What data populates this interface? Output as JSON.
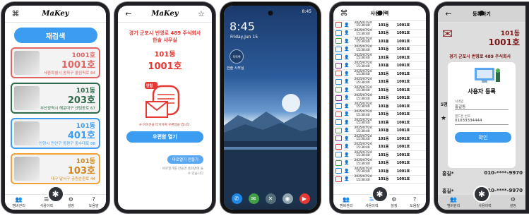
{
  "phone1": {
    "brand": "MaKey",
    "search_button": "재검색",
    "units": [
      {
        "dong": "1001호",
        "ho": "1001호",
        "addr": "세종특별시 송파구 올림픽로 84",
        "color": "#e06666"
      },
      {
        "dong": "101동",
        "ho": "203호",
        "addr": "부산광역시 해운대구 센텀동로 67",
        "color": "#2e6b4a"
      },
      {
        "dong": "101동",
        "ho": "401호",
        "addr": "안양시 만안구 동편구 중수대로 88",
        "color": "#3b9cf0"
      },
      {
        "dong": "101동",
        "ho": "103호",
        "addr": "대구 달서구 공원순환로 44",
        "color": "#f0a23b"
      }
    ],
    "nav": [
      {
        "icon": "users-icon",
        "label": "멤버관리"
      },
      {
        "icon": "history-icon",
        "label": "사용이력"
      },
      {
        "icon": "settings-icon",
        "label": "설정"
      },
      {
        "icon": "help-icon",
        "label": "도움말"
      }
    ]
  },
  "phone2": {
    "brand": "MaKey",
    "title": "경기 군포시 번영로 489 주식회사 한솔 사무실",
    "dong": "101동",
    "ho": "1001호",
    "badge": "단힘",
    "warning": "※ 아이콘을 터치하여 우편함을 엽니다.",
    "open_button": "우편함 열기",
    "make_key_button": "마로열기 만들기",
    "hint": "바로열기를 만들면 홈화면에 둘 수 있습니다"
  },
  "phone3": {
    "status_time": "8:45",
    "clock": "8:45",
    "date": "Friday,Jun 15",
    "app_icon": "독목팩",
    "app_label": "한솔 사무실"
  },
  "phone4": {
    "title": "사용이력",
    "rows": [
      {
        "date": "2025/07/24",
        "time": "15:30:40",
        "dong": "101동",
        "ho": "1001호",
        "color": "#e53935"
      },
      {
        "date": "2025/07/24",
        "time": "15:30:40",
        "dong": "101동",
        "ho": "1001호",
        "color": "#1e88e5"
      },
      {
        "date": "2025/07/24",
        "time": "15:30:40",
        "dong": "101동",
        "ho": "1001호",
        "color": "#43a047"
      },
      {
        "date": "2025/07/24",
        "time": "15:30:40",
        "dong": "101동",
        "ho": "1001호",
        "color": "#1e88e5"
      },
      {
        "date": "2025/07/24",
        "time": "15:30:40",
        "dong": "101동",
        "ho": "1001호",
        "color": "#1e88e5"
      },
      {
        "date": "2025/07/24",
        "time": "15:30:40",
        "dong": "101동",
        "ho": "1001호",
        "color": "#8e24aa"
      },
      {
        "date": "2025/07/24",
        "time": "15:30:40",
        "dong": "101동",
        "ho": "1001호",
        "color": "#e53935"
      },
      {
        "date": "2025/07/24",
        "time": "15:30:40",
        "dong": "101동",
        "ho": "1001호",
        "color": "#1e88e5"
      },
      {
        "date": "2025/07/24",
        "time": "15:30:40",
        "dong": "101동",
        "ho": "1001호",
        "color": "#43a047"
      },
      {
        "date": "2025/07/24",
        "time": "15:30:40",
        "dong": "101동",
        "ho": "1001호",
        "color": "#8e24aa"
      },
      {
        "date": "2025/07/24",
        "time": "15:30:40",
        "dong": "101동",
        "ho": "1001호",
        "color": "#1e88e5"
      },
      {
        "date": "2025/07/24",
        "time": "15:30:40",
        "dong": "101동",
        "ho": "1001호",
        "color": "#e53935"
      },
      {
        "date": "2025/07/24",
        "time": "15:30:40",
        "dong": "101동",
        "ho": "1001호",
        "color": "#1e88e5"
      },
      {
        "date": "2025/07/24",
        "time": "15:30:40",
        "dong": "101동",
        "ho": "1001호",
        "color": "#43a047"
      },
      {
        "date": "2025/07/24",
        "time": "15:30:40",
        "dong": "101동",
        "ho": "1001호",
        "color": "#8e24aa"
      },
      {
        "date": "2025/07/24",
        "time": "15:30:40",
        "dong": "101동",
        "ho": "1001호",
        "color": "#e53935"
      },
      {
        "date": "2025/07/24",
        "time": "15:30:40",
        "dong": "101동",
        "ho": "1001호",
        "color": "#1e88e5"
      },
      {
        "date": "2025/07/24",
        "time": "15:30:40",
        "dong": "101동",
        "ho": "1001호",
        "color": "#43a047"
      },
      {
        "date": "2025/07/24",
        "time": "15:30:40",
        "dong": "101동",
        "ho": "1001호",
        "color": "#1e88e5"
      },
      {
        "date": "2025/07/24",
        "time": "15:30:40",
        "dong": "101동",
        "ho": "1001호",
        "color": "#e53935"
      }
    ]
  },
  "phone5": {
    "title": "등록하기",
    "dong": "101동",
    "ho": "1001호",
    "addr": "경기 군포시 번영로 489 주식회사",
    "side_number": "5명",
    "modal_title": "사용자 등록",
    "name_label": "닉네임",
    "name_value": "홍길동",
    "phone_label": "핸드폰 번호",
    "phone_value": "01033334444",
    "confirm_button": "확인",
    "bottom_rows": [
      {
        "name": "홍길*",
        "phone": "010-****-9970"
      },
      {
        "name": "홍길*",
        "phone": "010-****-9970"
      }
    ]
  }
}
